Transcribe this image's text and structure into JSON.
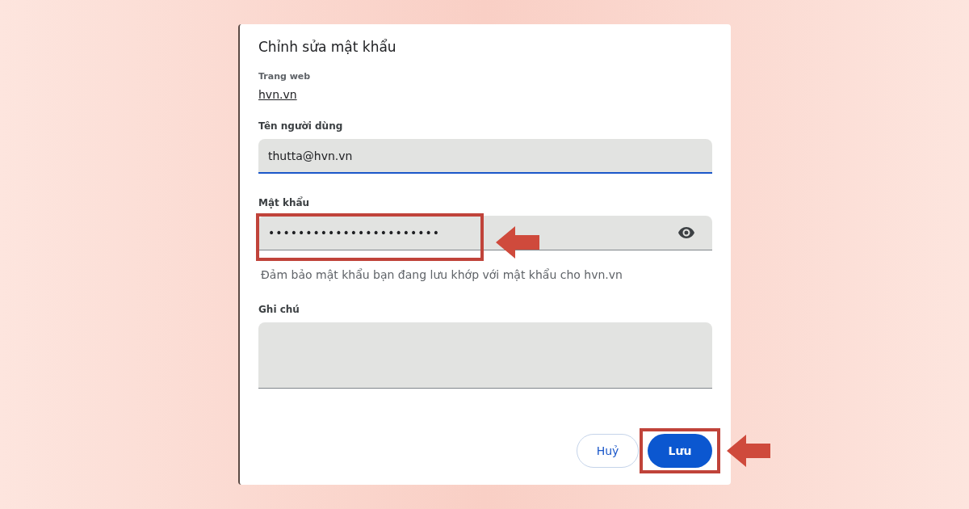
{
  "dialog": {
    "title": "Chỉnh sửa mật khẩu",
    "website": {
      "label": "Trang web",
      "value": "hvn.vn"
    },
    "username": {
      "label": "Tên người dùng",
      "value": "thutta@hvn.vn",
      "focused": true
    },
    "password": {
      "label": "Mật khẩu",
      "value": "•••••••••••••••••••••••",
      "focused": false,
      "highlighted": true
    },
    "hint": "Đảm bảo mật khẩu bạn đang lưu khớp với mật khẩu cho hvn.vn",
    "note": {
      "label": "Ghi chú",
      "focused": false
    },
    "buttons": [
      {
        "label": "Huỷ",
        "kind": "secondary",
        "highlighted": false
      },
      {
        "label": "Lưu",
        "kind": "primary",
        "highlighted": true
      }
    ]
  }
}
